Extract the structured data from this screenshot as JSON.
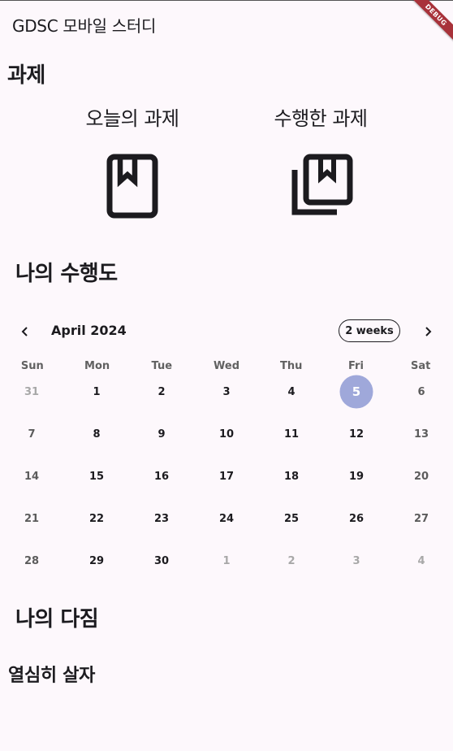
{
  "appbar": {
    "title": "GDSC 모바일 스터디",
    "debug_banner": "DEBUG"
  },
  "tasks": {
    "section_title": "과제",
    "today": {
      "label": "오늘의 과제",
      "icon": "bookmark-book-icon"
    },
    "done": {
      "label": "수행한 과제",
      "icon": "library-books-icon"
    }
  },
  "progress": {
    "section_title": "나의 수행도"
  },
  "calendar": {
    "month_title": "April 2024",
    "format_button": "2 weeks",
    "selected_color": "#9fa8da",
    "weekdays": [
      "Sun",
      "Mon",
      "Tue",
      "Wed",
      "Thu",
      "Fri",
      "Sat"
    ],
    "weeks": [
      [
        "31",
        "1",
        "2",
        "3",
        "4",
        "5",
        "6"
      ],
      [
        "7",
        "8",
        "9",
        "10",
        "11",
        "12",
        "13"
      ],
      [
        "14",
        "15",
        "16",
        "17",
        "18",
        "19",
        "20"
      ],
      [
        "21",
        "22",
        "23",
        "24",
        "25",
        "26",
        "27"
      ],
      [
        "28",
        "29",
        "30",
        "1",
        "2",
        "3",
        "4"
      ]
    ]
  },
  "resolution": {
    "section_title": "나의 다짐",
    "text": "열심히 살자"
  }
}
